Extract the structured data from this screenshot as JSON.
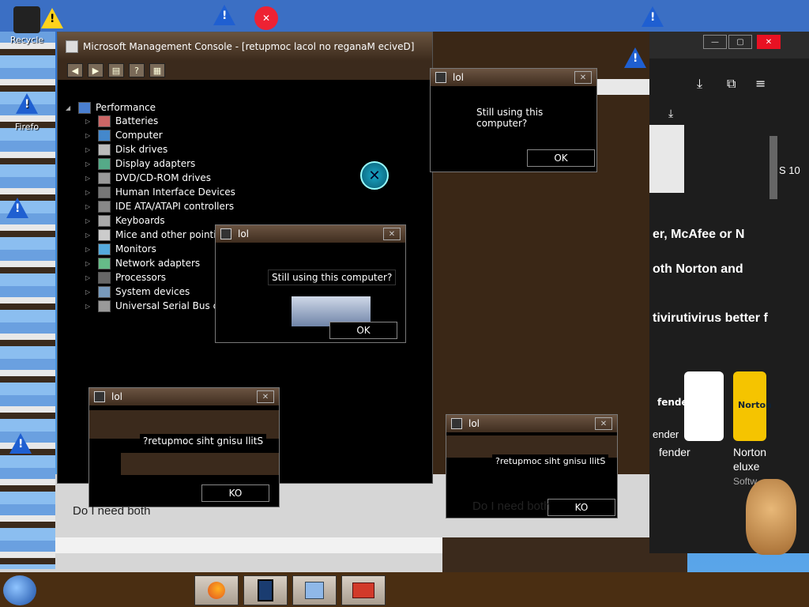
{
  "desktop": {
    "icons": [
      {
        "label": "Recycle"
      },
      {
        "label": "Firefo"
      }
    ]
  },
  "mmc": {
    "title": "Microsoft Management Console - [retupmoc lacol no reganaM eciveD]",
    "toolbar": {
      "help_label": "?"
    },
    "tree_root": "Performance",
    "tree_items": [
      {
        "label": "Batteries"
      },
      {
        "label": "Computer"
      },
      {
        "label": "Disk drives"
      },
      {
        "label": "Display adapters"
      },
      {
        "label": "DVD/CD-ROM drives"
      },
      {
        "label": "Human Interface Devices"
      },
      {
        "label": "IDE ATA/ATAPI controllers"
      },
      {
        "label": "Keyboards"
      },
      {
        "label": "Mice and other pointing"
      },
      {
        "label": "Monitors"
      },
      {
        "label": "Network adapters"
      },
      {
        "label": "Processors"
      },
      {
        "label": "System devices"
      },
      {
        "label": "Universal Serial Bus cont"
      }
    ]
  },
  "dialogs": [
    {
      "title": "lol",
      "message": "Still using this computer?",
      "ok": "OK"
    },
    {
      "title": "lol",
      "message": "Still using this computer?",
      "ok": "OK"
    },
    {
      "title": "lol",
      "message": "?retupmoc siht gnisu llitS",
      "ok": "KO",
      "sub": "Do I need both"
    },
    {
      "title": "lol",
      "message": "?retupmoc siht gnisu llitS",
      "ok": "KO",
      "sub": "Do I need both"
    }
  ],
  "browser": {
    "lines": [
      {
        "text": "S 10"
      },
      {
        "text": "er, McAfee or N"
      },
      {
        "text": "oth Norton and"
      },
      {
        "text": "tivirutivirus better f"
      },
      {
        "text": "fender"
      },
      {
        "text": "Norton"
      },
      {
        "text": "eluxe"
      },
      {
        "text": "Softw"
      },
      {
        "text": "ender"
      }
    ],
    "card_label": "fender",
    "card_label2": "Norton"
  },
  "colors": {
    "accent": "#3d8de0",
    "warn": "#ffd21c",
    "taskbar": "#4a2e12"
  }
}
